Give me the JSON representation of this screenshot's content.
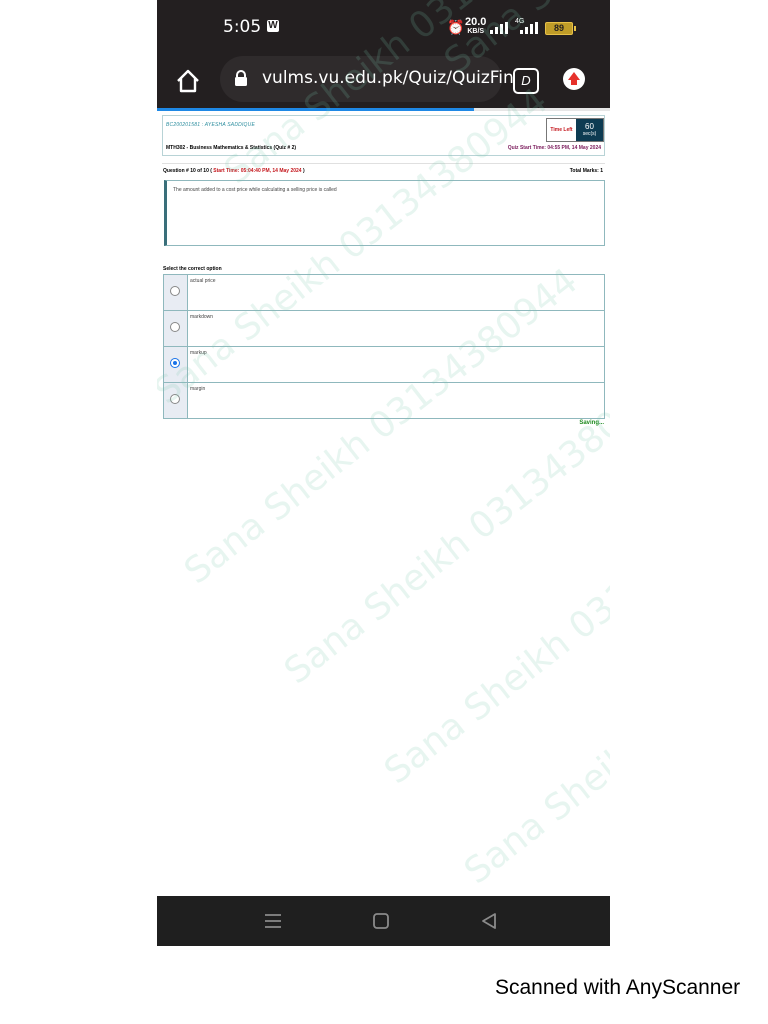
{
  "status_bar": {
    "time": "5:05",
    "app_badge": "W",
    "net_speed": "20.0",
    "net_unit": "KB/S",
    "network_type": "4G",
    "battery": "89"
  },
  "browser": {
    "url": "vulms.vu.edu.pk/Quiz/QuizFin",
    "tabs_icon": "D",
    "load_progress": 0.7
  },
  "quiz": {
    "student": "BC200201581 : AYESHA SADDIQUE",
    "course": "MTH302 - Business Mathematics & Statistics (Quiz # 2)",
    "quiz_start_time": "Quiz Start Time: 04:55 PM, 14 May 2024",
    "time_left_label": "Time Left",
    "time_left_value": "60",
    "time_left_unit": "sec(s)",
    "question_number": "Question # 10 of 10 (",
    "question_start": "Start Time: 05:04:40 PM, 14 May 2024",
    "question_close": ")",
    "total_marks": "Total Marks: 1",
    "question_text": "The amount added to a cost price while calculating a selling price is called",
    "select_label": "Select the correct option",
    "options": [
      {
        "label": "actual price",
        "selected": false
      },
      {
        "label": "markdown",
        "selected": false
      },
      {
        "label": "markup",
        "selected": true
      },
      {
        "label": "margin",
        "selected": false
      }
    ],
    "saving": "Saving..."
  },
  "watermark": "Sana Sheikh 03134380944",
  "footer": "Scanned with AnyScanner"
}
